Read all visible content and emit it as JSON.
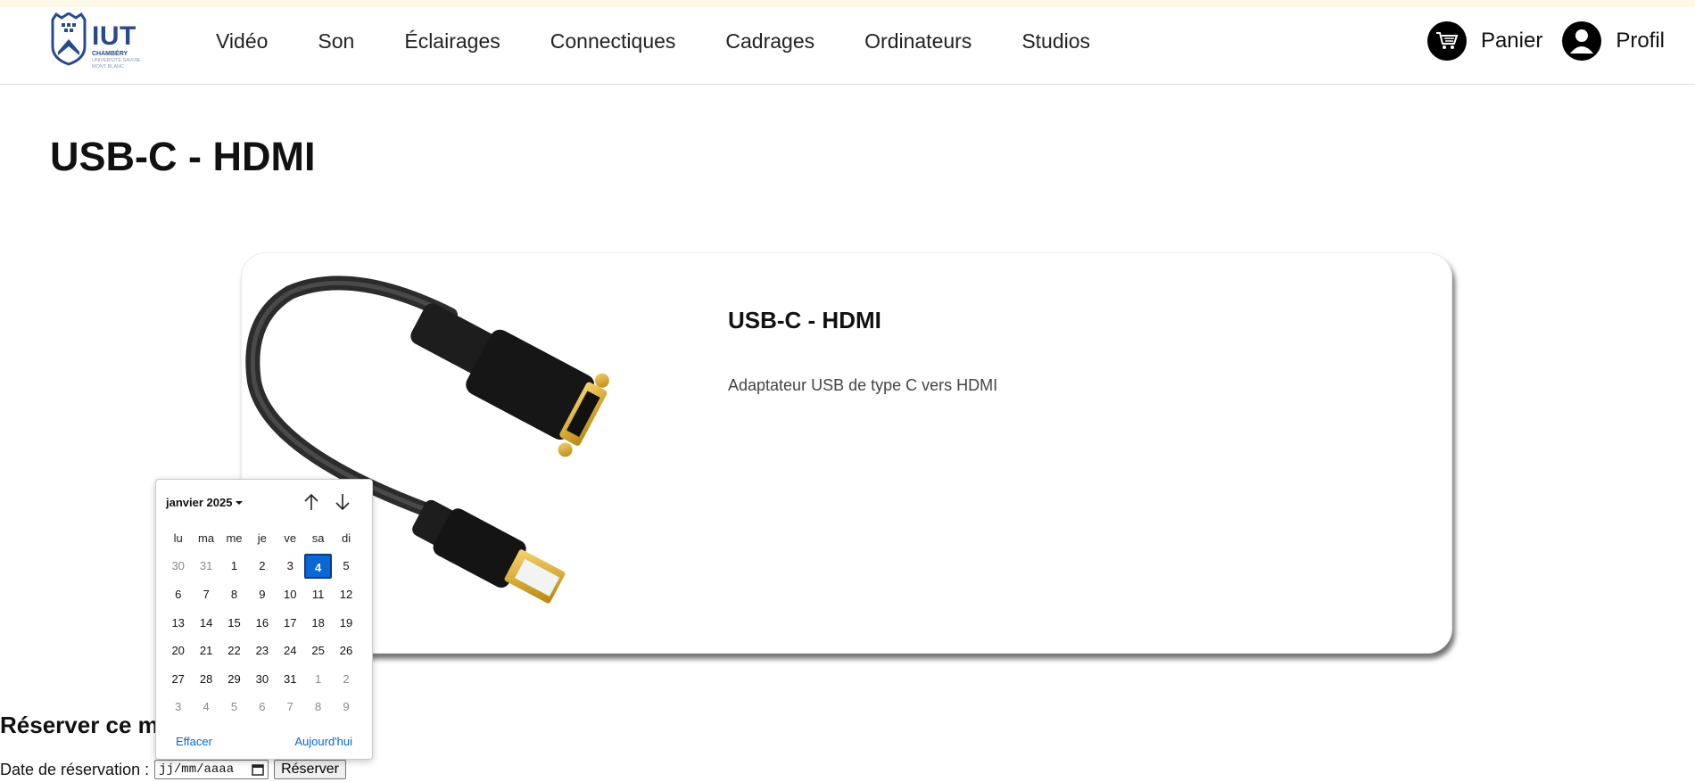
{
  "header": {
    "logo": {
      "main": "IUT",
      "sub": "CHAMBÉRY",
      "sub2": "UNIVERSITÉ SAVOIE MONT BLANC"
    },
    "nav": [
      "Vidéo",
      "Son",
      "Éclairages",
      "Connectiques",
      "Cadrages",
      "Ordinateurs",
      "Studios"
    ],
    "cart_label": "Panier",
    "profile_label": "Profil"
  },
  "page": {
    "title": "USB-C - HDMI"
  },
  "product": {
    "title": "USB-C - HDMI",
    "description": "Adaptateur USB de type C vers HDMI"
  },
  "reservation": {
    "title": "Réserver ce m",
    "date_label": "Date de réservation :",
    "date_placeholder": "jj/mm/aaaa",
    "button": "Réserver"
  },
  "calendar": {
    "month_label": "janvier 2025",
    "weekdays": [
      "lu",
      "ma",
      "me",
      "je",
      "ve",
      "sa",
      "di"
    ],
    "weeks": [
      [
        {
          "d": "30",
          "o": true
        },
        {
          "d": "31",
          "o": true
        },
        {
          "d": "1"
        },
        {
          "d": "2"
        },
        {
          "d": "3"
        },
        {
          "d": "4",
          "sel": true
        },
        {
          "d": "5"
        }
      ],
      [
        {
          "d": "6"
        },
        {
          "d": "7"
        },
        {
          "d": "8"
        },
        {
          "d": "9"
        },
        {
          "d": "10"
        },
        {
          "d": "11"
        },
        {
          "d": "12"
        }
      ],
      [
        {
          "d": "13"
        },
        {
          "d": "14"
        },
        {
          "d": "15"
        },
        {
          "d": "16"
        },
        {
          "d": "17"
        },
        {
          "d": "18"
        },
        {
          "d": "19"
        }
      ],
      [
        {
          "d": "20"
        },
        {
          "d": "21"
        },
        {
          "d": "22"
        },
        {
          "d": "23"
        },
        {
          "d": "24"
        },
        {
          "d": "25"
        },
        {
          "d": "26"
        }
      ],
      [
        {
          "d": "27"
        },
        {
          "d": "28"
        },
        {
          "d": "29"
        },
        {
          "d": "30"
        },
        {
          "d": "31"
        },
        {
          "d": "1",
          "o": true
        },
        {
          "d": "2",
          "o": true
        }
      ],
      [
        {
          "d": "3",
          "o": true
        },
        {
          "d": "4",
          "o": true
        },
        {
          "d": "5",
          "o": true
        },
        {
          "d": "6",
          "o": true
        },
        {
          "d": "7",
          "o": true
        },
        {
          "d": "8",
          "o": true
        },
        {
          "d": "9",
          "o": true
        }
      ]
    ],
    "clear_label": "Effacer",
    "today_label": "Aujourd'hui"
  },
  "colors": {
    "accent": "#0b67d4",
    "brand": "#2a4a8e",
    "topstrip": "#fdf8e8"
  }
}
